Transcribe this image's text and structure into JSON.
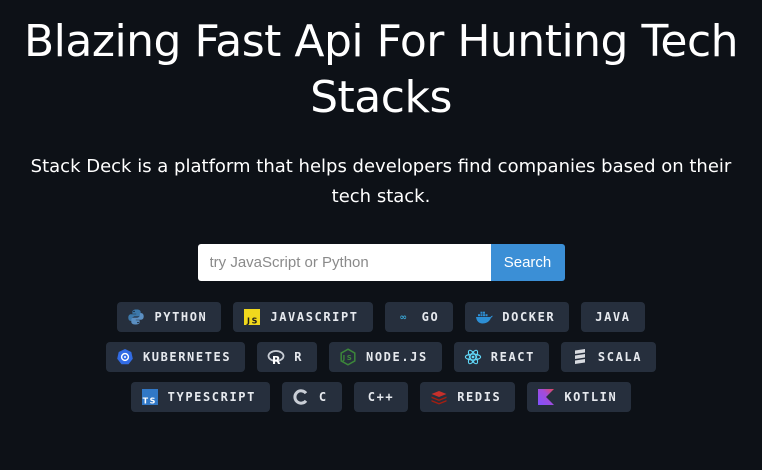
{
  "hero": {
    "title": "Blazing Fast Api For Hunting Tech Stacks",
    "subtitle": "Stack Deck is a platform that helps developers find companies based on their tech stack."
  },
  "search": {
    "placeholder": "try JavaScript or Python",
    "value": "",
    "button_label": "Search"
  },
  "tags": [
    [
      {
        "label": "PYTHON",
        "icon": "python-icon"
      },
      {
        "label": "JAVASCRIPT",
        "icon": "javascript-icon"
      },
      {
        "label": "GO",
        "icon": "go-icon"
      },
      {
        "label": "DOCKER",
        "icon": "docker-icon"
      },
      {
        "label": "JAVA",
        "icon": "none"
      }
    ],
    [
      {
        "label": "KUBERNETES",
        "icon": "kubernetes-icon"
      },
      {
        "label": "R",
        "icon": "r-icon"
      },
      {
        "label": "NODE.JS",
        "icon": "nodejs-icon"
      },
      {
        "label": "REACT",
        "icon": "react-icon"
      },
      {
        "label": "SCALA",
        "icon": "scala-icon"
      }
    ],
    [
      {
        "label": "TYPESCRIPT",
        "icon": "typescript-icon"
      },
      {
        "label": "C",
        "icon": "c-icon"
      },
      {
        "label": "C++",
        "icon": "none"
      },
      {
        "label": "REDIS",
        "icon": "redis-icon"
      },
      {
        "label": "KOTLIN",
        "icon": "kotlin-icon"
      }
    ]
  ],
  "colors": {
    "background": "#0d1117",
    "tag_background": "#262f3d",
    "search_button": "#3b8fd6"
  }
}
